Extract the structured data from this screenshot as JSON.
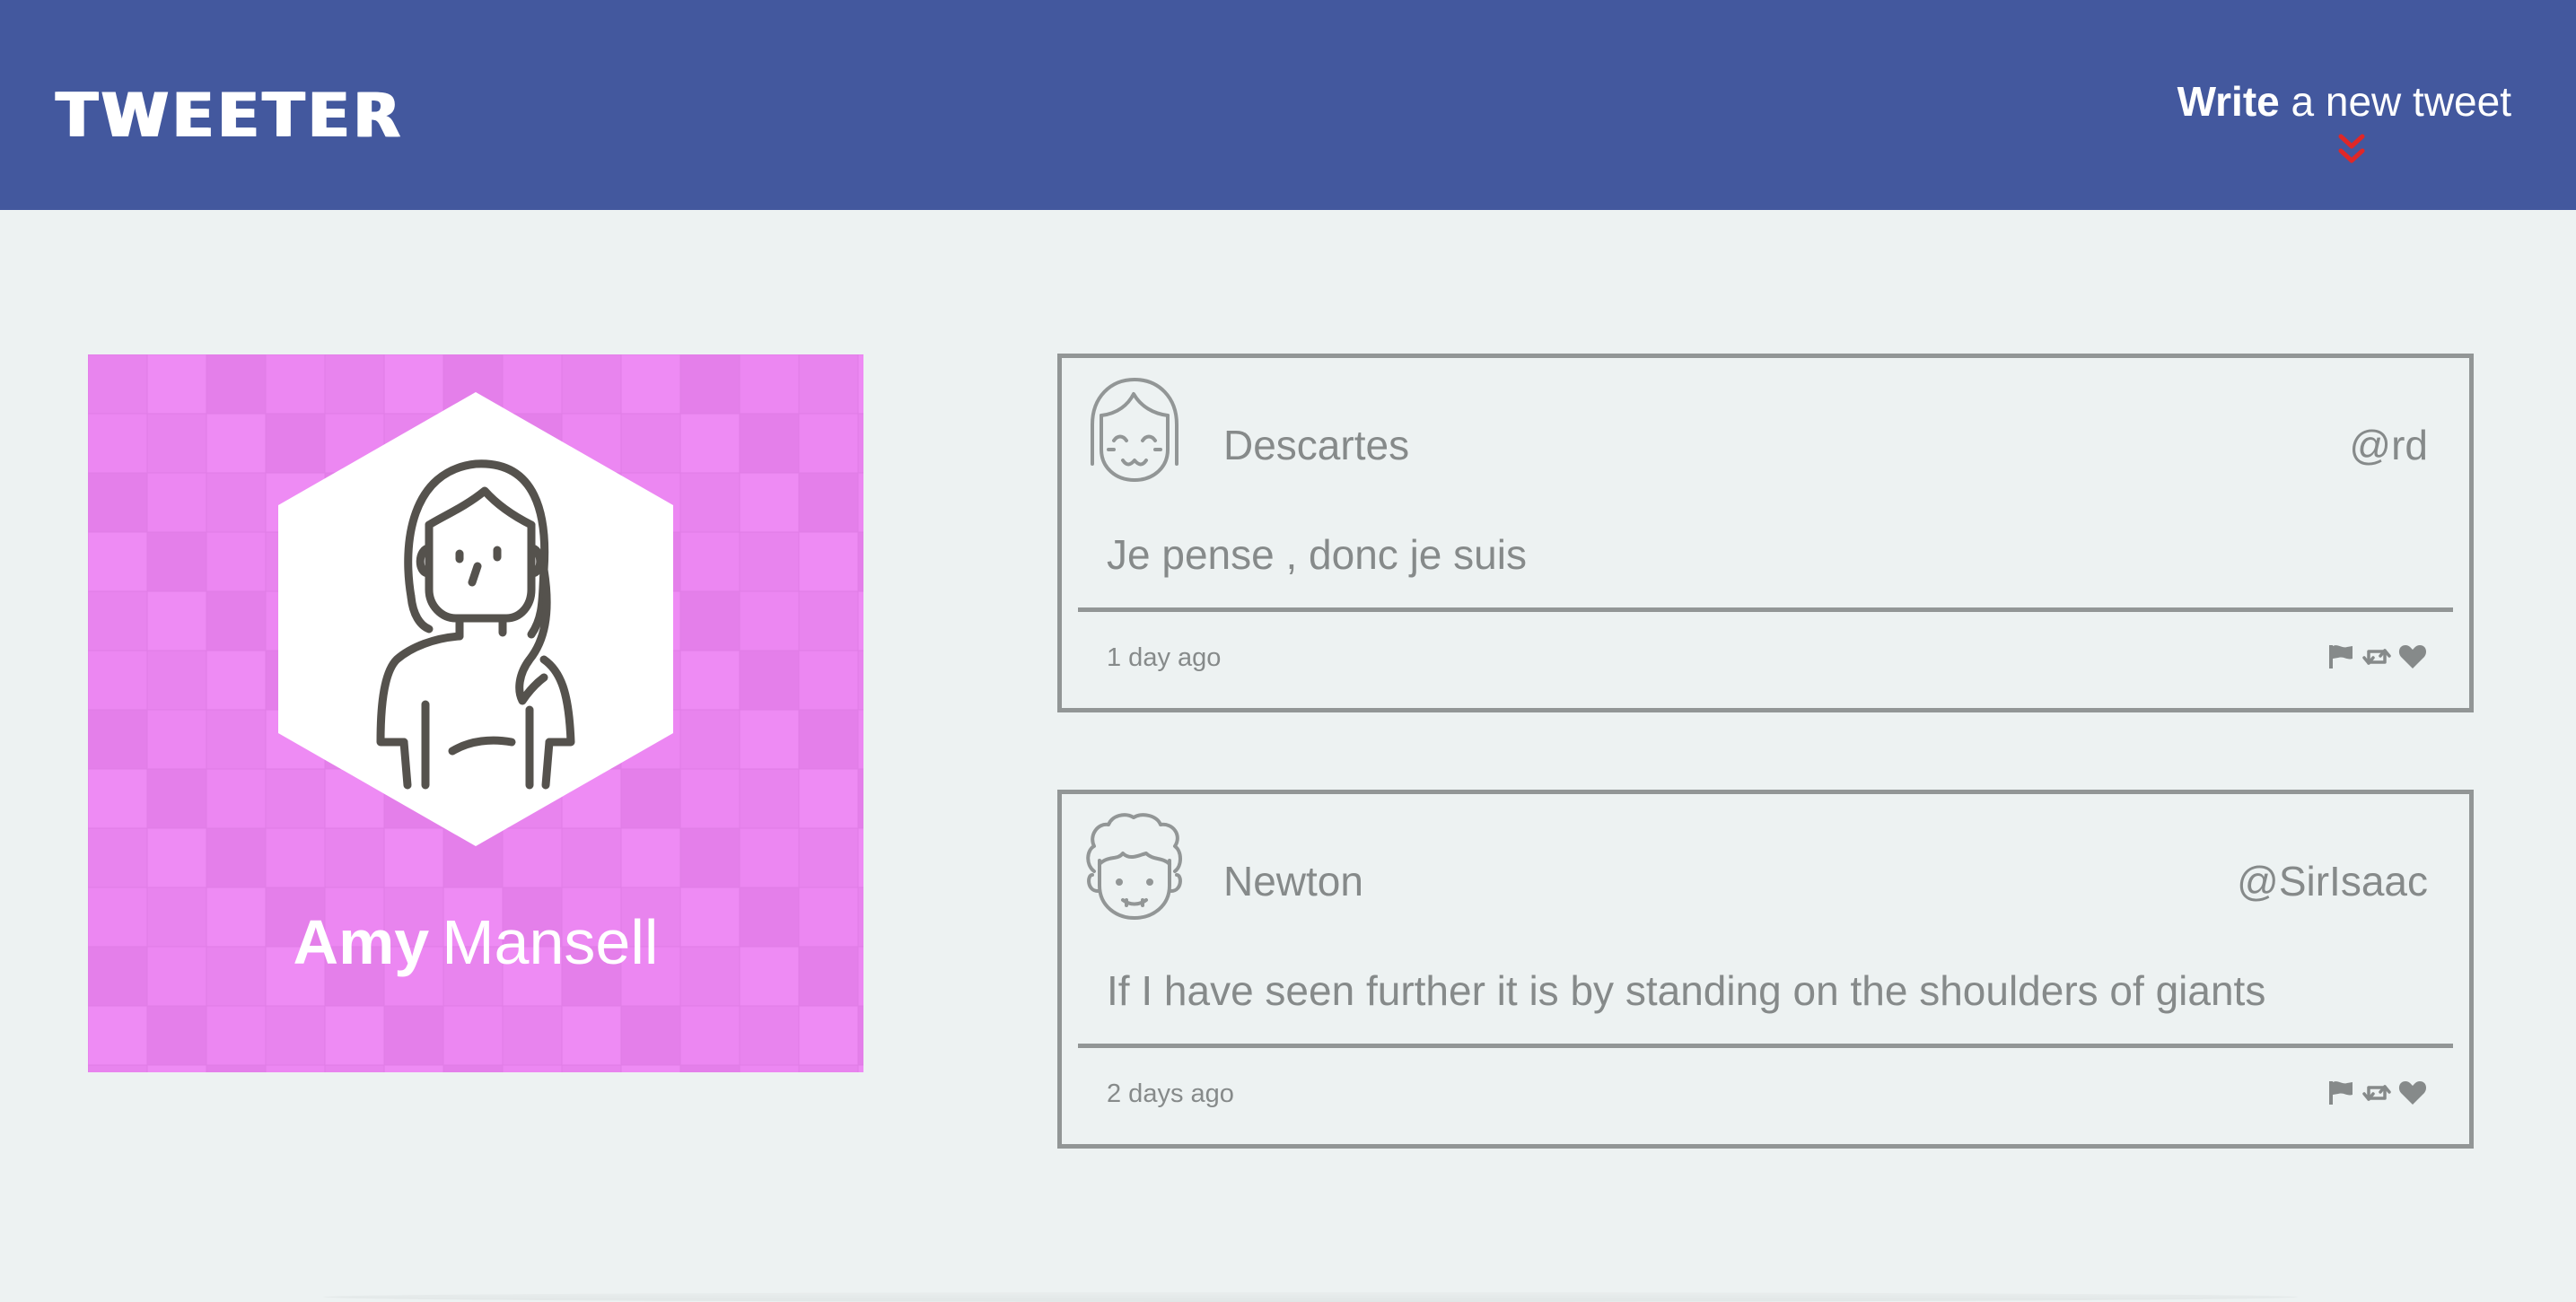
{
  "header": {
    "logo": "TWEETER",
    "compose": {
      "strong": "Write",
      "light": "a new tweet"
    },
    "chevron_icon": "chevron-double-down-icon",
    "background_color": "#43589e",
    "accent_color": "#e02727"
  },
  "profile": {
    "first_name": "Amy",
    "last_name": "Mansell",
    "background_color": "#ec87f2",
    "avatar_icon": "woman-avatar-icon"
  },
  "tweets": [
    {
      "display_name": "Descartes",
      "handle": "@rd",
      "content": "Je pense , donc je suis",
      "timestamp": "1 day ago",
      "avatar_icon": "girl-face-avatar-icon"
    },
    {
      "display_name": "Newton",
      "handle": "@SirIsaac",
      "content": "If I have seen further it is by standing on the shoulders of giants",
      "timestamp": "2 days ago",
      "avatar_icon": "curly-hair-face-avatar-icon"
    }
  ],
  "actions": [
    "flag-icon",
    "retweet-icon",
    "heart-icon"
  ],
  "colors": {
    "page_background": "#edf2f2",
    "tweet_text": "#868a8a",
    "tweet_border": "#929696"
  }
}
